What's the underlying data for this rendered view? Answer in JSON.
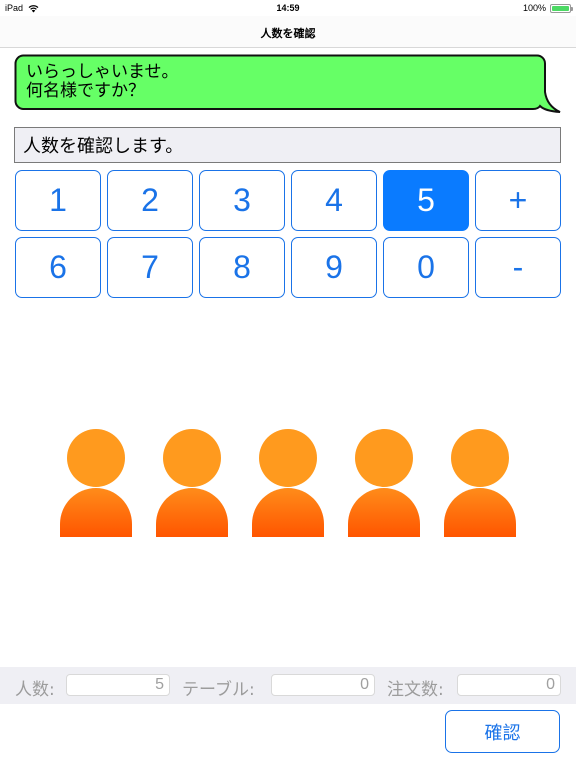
{
  "status_bar": {
    "device": "iPad",
    "time": "14:59",
    "battery": "100%",
    "wifi_icon": "wifi-icon",
    "battery_icon": "battery-icon"
  },
  "nav": {
    "title": "人数を確認"
  },
  "bubble": {
    "text": "いらっしゃいませ。\n何名様ですか？",
    "color": "#66ff66"
  },
  "message": {
    "text": "人数を確認します。"
  },
  "keypad": {
    "keys": [
      "1",
      "2",
      "3",
      "4",
      "5",
      "+",
      "6",
      "7",
      "8",
      "9",
      "0",
      "-"
    ],
    "selected": "5",
    "accent": "#0a7bff"
  },
  "people": {
    "count": 5,
    "icon": "person-icon",
    "colors": {
      "head": "#ff9a1e",
      "body_top": "#ff8c1a",
      "body_bottom": "#ff5500"
    }
  },
  "info_bar": {
    "people_label": "人数:",
    "people_value": "5",
    "table_label": "テーブル:",
    "table_value": "0",
    "orders_label": "注文数:",
    "orders_value": "0"
  },
  "confirm_button": {
    "label": "確認"
  }
}
